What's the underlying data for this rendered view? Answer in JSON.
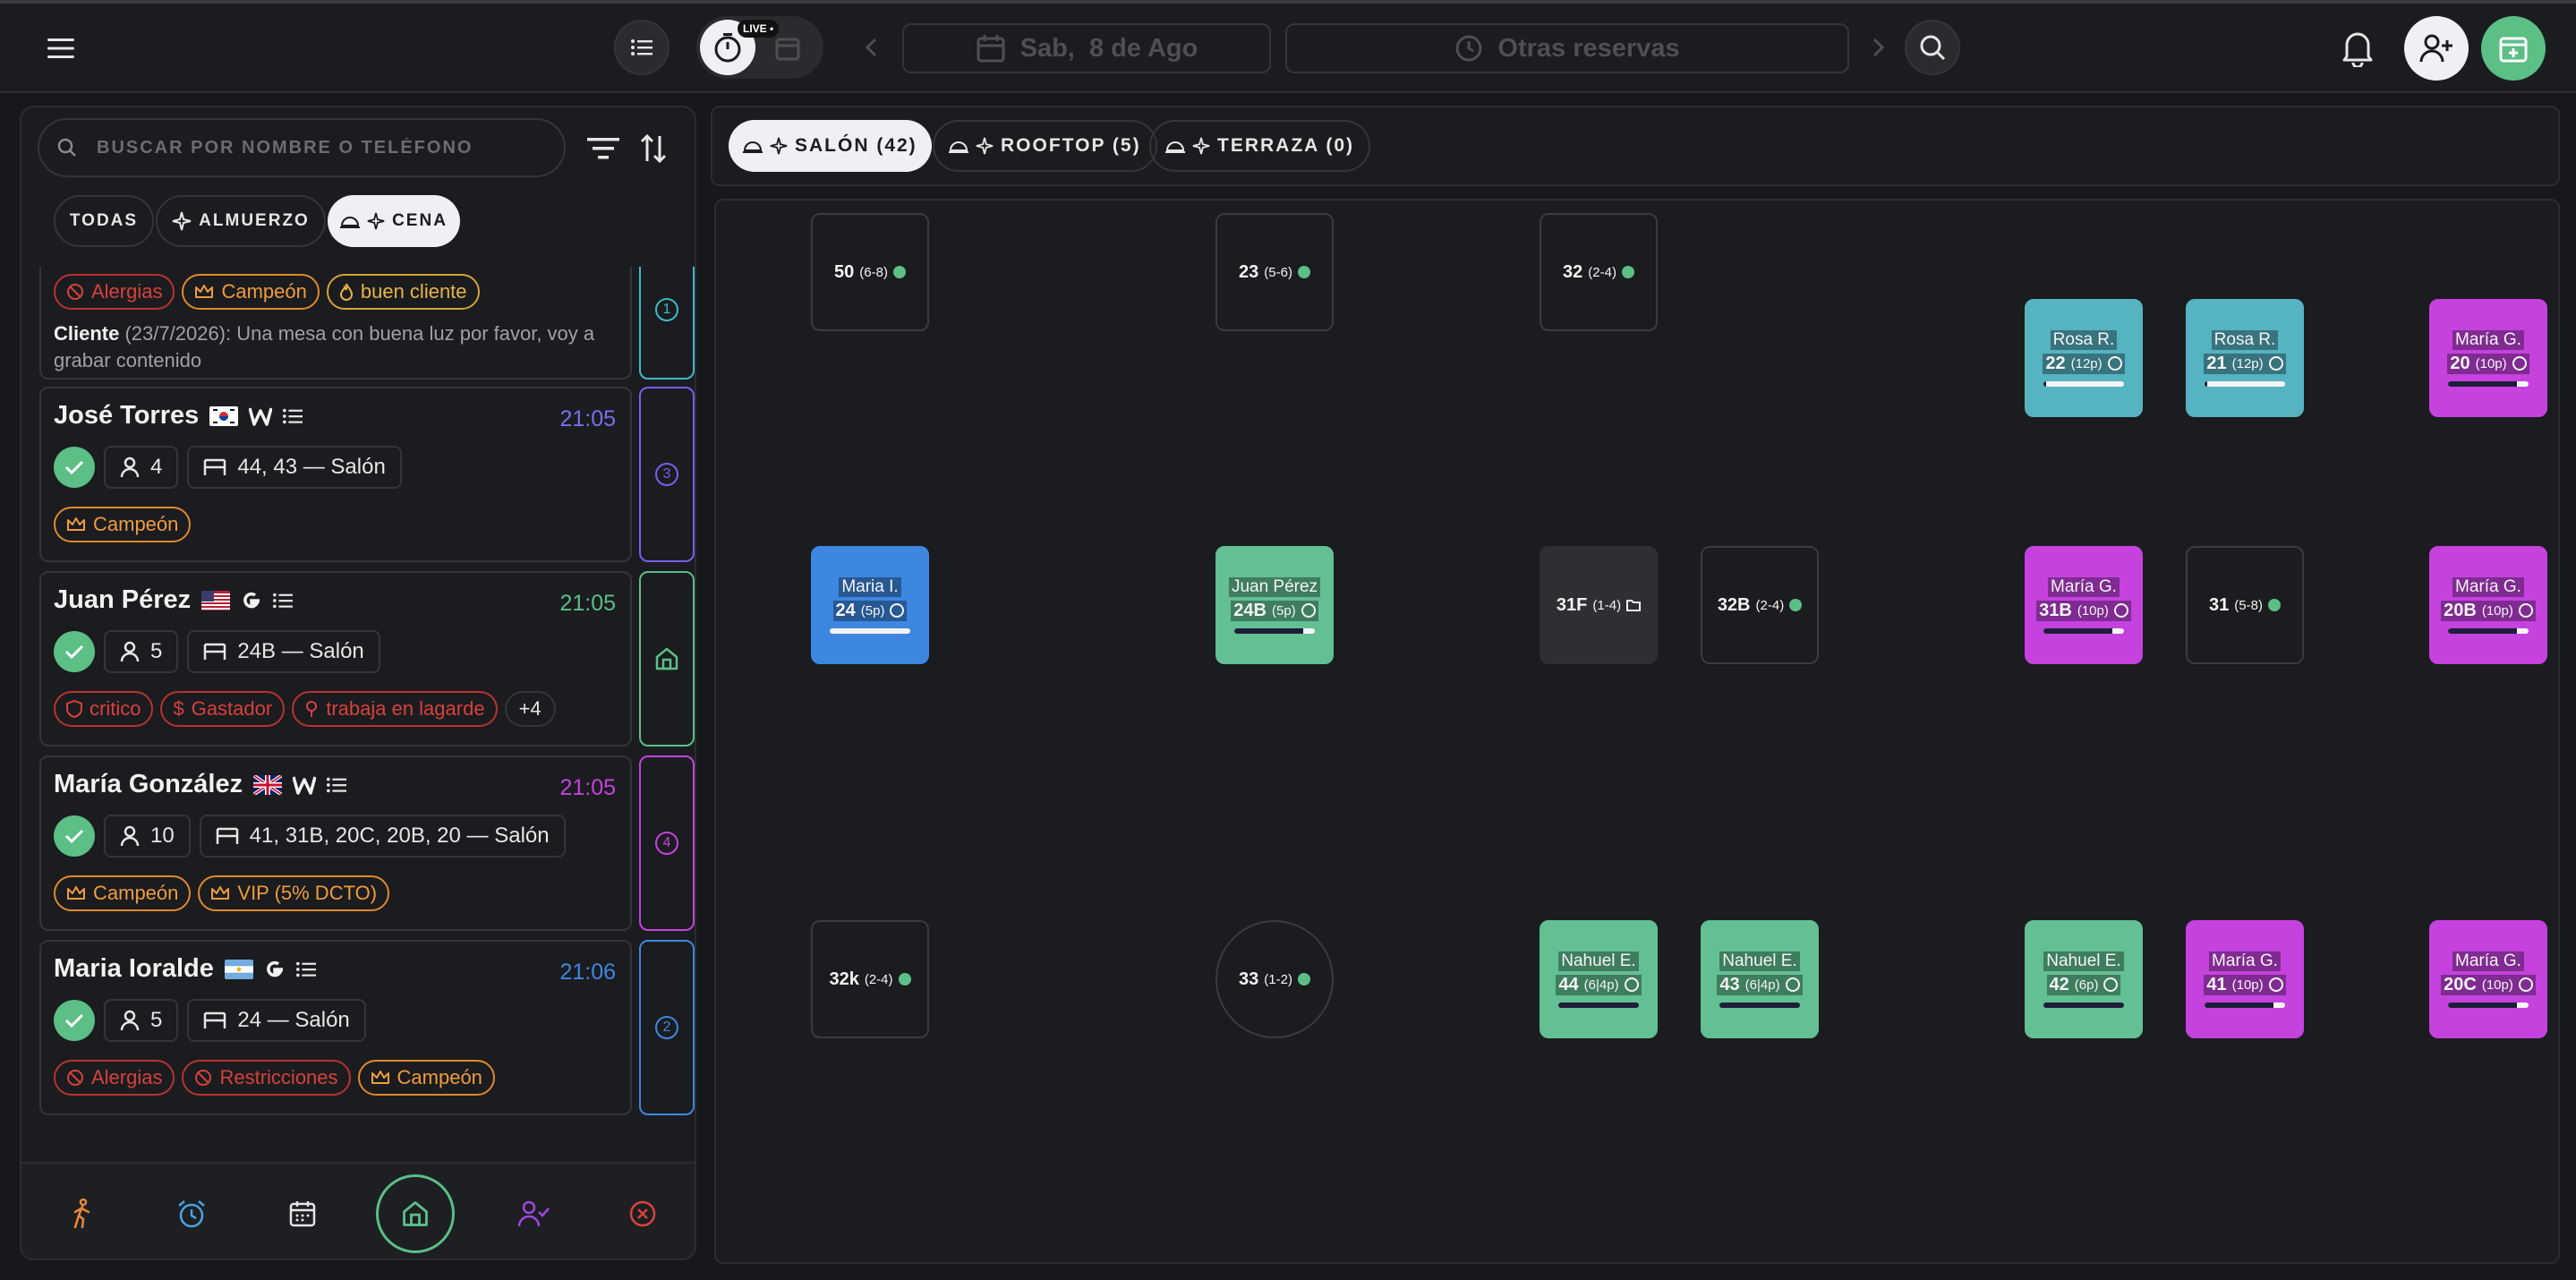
{
  "topbar": {
    "live_badge": "LIVE •",
    "date": "Sab,  8 de Ago",
    "other_bookings": "Otras reservas"
  },
  "search": {
    "placeholder": "BUSCAR POR NOMBRE O TELÉFONO"
  },
  "shift_filters": [
    {
      "label": "TODAS",
      "active": false
    },
    {
      "label": "ALMUERZO",
      "active": false
    },
    {
      "label": "CENA",
      "active": true
    }
  ],
  "partial_card": {
    "tags": [
      "Alergias",
      "Campeón",
      "buen cliente"
    ],
    "note_author": "Cliente",
    "note_date": "(23/7/2026)",
    "note_text": ": Una mesa con buena luz por favor, voy a grabar contenido",
    "side_number": "1"
  },
  "reservations": [
    {
      "name": "José Torres",
      "flag": "kr",
      "source_icon": "w",
      "time": "21:05",
      "time_color": "#7b6ef0",
      "guests": "4",
      "tables": "44, 43 — Salón",
      "tags": [
        {
          "label": "Campeón",
          "type": "orange"
        }
      ],
      "side_number": "3",
      "side_color": "#7b5cf0"
    },
    {
      "name": "Juan Pérez",
      "flag": "us",
      "source_icon": "g",
      "time": "21:05",
      "time_color": "#5bbf86",
      "guests": "5",
      "tables": "24B — Salón",
      "tags": [
        {
          "label": "critico",
          "type": "red"
        },
        {
          "label": "Gastador",
          "type": "red"
        },
        {
          "label": "trabaja en lagarde",
          "type": "red"
        }
      ],
      "more": "+4",
      "side_number": "",
      "side_color": "#5bbf86"
    },
    {
      "name": "María González",
      "flag": "gb",
      "source_icon": "w",
      "time": "21:05",
      "time_color": "#c542df",
      "guests": "10",
      "tables": "41, 31B, 20C, 20B, 20 — Salón",
      "tags": [
        {
          "label": "Campeón",
          "type": "orange"
        },
        {
          "label": "VIP (5% DCTO)",
          "type": "orange"
        }
      ],
      "side_number": "4",
      "side_color": "#c542df"
    },
    {
      "name": "Maria Ioralde",
      "flag": "ar",
      "source_icon": "g",
      "time": "21:06",
      "time_color": "#3d87e0",
      "guests": "5",
      "tables": "24 — Salón",
      "tags": [
        {
          "label": "Alergias",
          "type": "red"
        },
        {
          "label": "Restricciones",
          "type": "red"
        },
        {
          "label": "Campeón",
          "type": "orange"
        }
      ],
      "side_number": "2",
      "side_color": "#3d87e0"
    }
  ],
  "zones": [
    {
      "label": "SALÓN (42)",
      "active": true
    },
    {
      "label": "ROOFTOP (5)",
      "active": false
    },
    {
      "label": "TERRAZA (0)",
      "active": false
    }
  ],
  "tables": [
    {
      "id": "50",
      "cap": "(6-8)",
      "status": "free"
    },
    {
      "id": "23",
      "cap": "(5-6)",
      "status": "free"
    },
    {
      "id": "32",
      "cap": "(2-4)",
      "status": "free"
    },
    {
      "id": "22",
      "cap": "(12p)",
      "status": "teal",
      "guest": "Rosa R.",
      "fill": 0.03
    },
    {
      "id": "21",
      "cap": "(12p)",
      "status": "teal",
      "guest": "Rosa R.",
      "fill": 0.03
    },
    {
      "id": "20",
      "cap": "(10p)",
      "status": "purple",
      "guest": "María G.",
      "fill": 0.85
    },
    {
      "id": "24",
      "cap": "(5p)",
      "status": "blue",
      "guest": "Maria I.",
      "fill": 1.0
    },
    {
      "id": "24B",
      "cap": "(5p)",
      "status": "green",
      "guest": "Juan Pérez",
      "fill": 0.85
    },
    {
      "id": "31F",
      "cap": "(1-4)",
      "status": "blocked"
    },
    {
      "id": "32B",
      "cap": "(2-4)",
      "status": "free"
    },
    {
      "id": "31B",
      "cap": "(10p)",
      "status": "purple",
      "guest": "María G.",
      "fill": 0.85
    },
    {
      "id": "31",
      "cap": "(5-8)",
      "status": "free"
    },
    {
      "id": "20B",
      "cap": "(10p)",
      "status": "purple",
      "guest": "María G.",
      "fill": 0.85
    },
    {
      "id": "32k",
      "cap": "(2-4)",
      "status": "free"
    },
    {
      "id": "33",
      "cap": "(1-2)",
      "status": "free"
    },
    {
      "id": "44",
      "cap": "(6|4p)",
      "status": "green",
      "guest": "Nahuel E.",
      "fill": 1.0
    },
    {
      "id": "43",
      "cap": "(6|4p)",
      "status": "green",
      "guest": "Nahuel E.",
      "fill": 1.0
    },
    {
      "id": "42",
      "cap": "(6p)",
      "status": "green",
      "guest": "Nahuel E.",
      "fill": 1.0
    },
    {
      "id": "41",
      "cap": "(10p)",
      "status": "purple",
      "guest": "María G.",
      "fill": 0.85
    },
    {
      "id": "20C",
      "cap": "(10p)",
      "status": "purple",
      "guest": "María G.",
      "fill": 0.85
    }
  ]
}
